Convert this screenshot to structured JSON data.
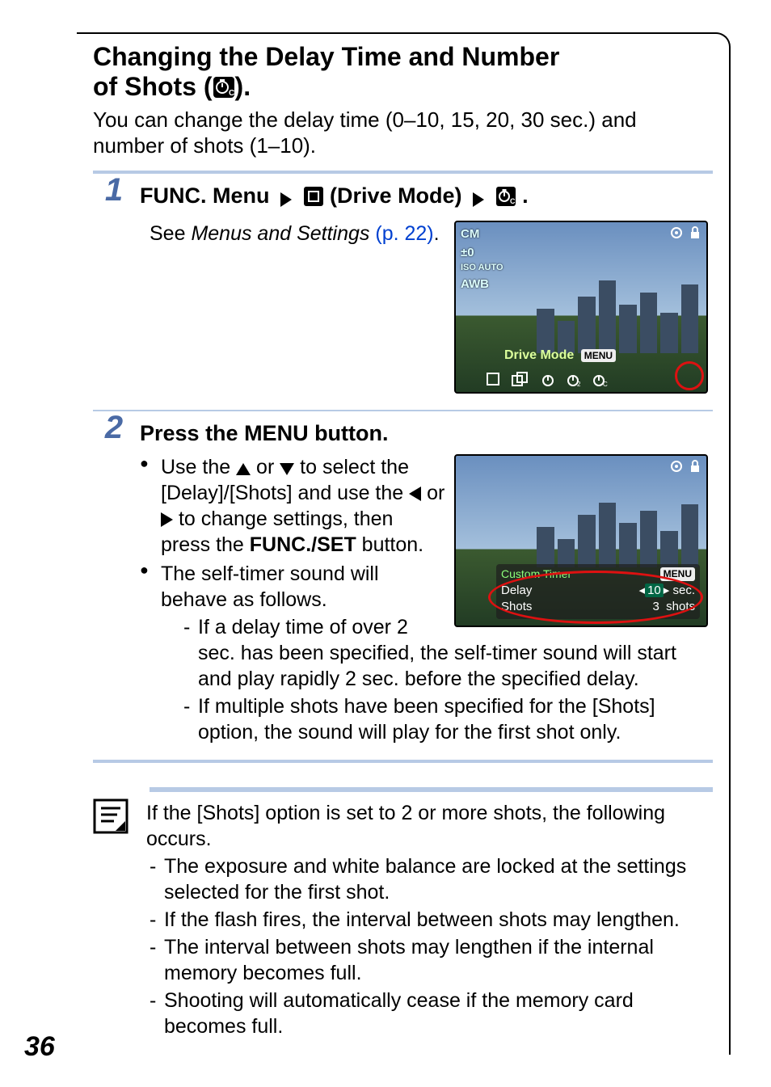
{
  "page_number": "36",
  "title_line1": "Changing the Delay Time and Number",
  "title_line2_prefix": "of Shots (",
  "title_line2_suffix": ").",
  "intro": "You can change the delay time (0–10, 15, 20, 30 sec.) and number of shots (1–10).",
  "steps": [
    {
      "num": "1",
      "head_prefix": "FUNC. Menu",
      "head_mid": "(Drive Mode)",
      "head_suffix": ".",
      "see_prefix": "See ",
      "see_italic": "Menus and Settings",
      "see_ref": "(p. 22)",
      "see_suffix": ".",
      "screenshot": {
        "left_icons": [
          "CM",
          "±0",
          "ISO\nAUTO",
          "AWB"
        ],
        "drive_label": "Drive Mode",
        "menu_badge": "MENU"
      }
    },
    {
      "num": "2",
      "head": "Press the MENU button.",
      "b1_a": "Use the ",
      "b1_b": " or ",
      "b1_c": " to select the [Delay]/[Shots] and use the ",
      "b1_d": " or ",
      "b1_e": " to change settings, then press the ",
      "b1_f": "FUNC./SET",
      "b1_g": " button.",
      "b2": "The self-timer sound will behave as follows.",
      "d1": "If a delay time of over 2 sec. has been specified, the self-timer sound will start and play rapidly 2 sec. before the specified delay.",
      "d2": "If multiple shots have been specified for the [Shots] option, the sound will play for the first shot only.",
      "screenshot": {
        "title": "Custom Timer",
        "menu_badge": "MENU",
        "row1_label": "Delay",
        "row1_val": "10",
        "row1_unit": "sec.",
        "row2_label": "Shots",
        "row2_val": "3",
        "row2_unit": "shots"
      }
    }
  ],
  "note": {
    "intro": "If the [Shots] option is set to 2 or more shots, the following occurs.",
    "items": [
      "The exposure and white balance are locked at the settings selected for the first shot.",
      "If the flash fires, the interval between shots may lengthen.",
      "The interval between shots may lengthen if the internal memory becomes full.",
      "Shooting will automatically cease if the memory card becomes full."
    ]
  }
}
